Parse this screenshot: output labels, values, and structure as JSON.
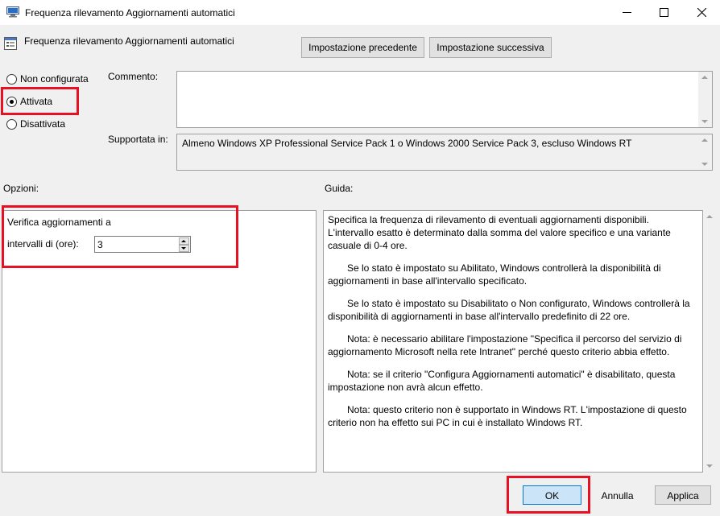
{
  "window": {
    "title": "Frequenza rilevamento Aggiornamenti automatici"
  },
  "header": {
    "policy_name": "Frequenza rilevamento Aggiornamenti automatici",
    "prev_label": "Impostazione precedente",
    "next_label": "Impostazione successiva"
  },
  "state": {
    "options": [
      {
        "label": "Non configurata",
        "selected": false
      },
      {
        "label": "Attivata",
        "selected": true
      },
      {
        "label": "Disattivata",
        "selected": false
      }
    ]
  },
  "comment": {
    "label": "Commento:",
    "value": ""
  },
  "supported": {
    "label": "Supportata in:",
    "value": "Almeno Windows XP Professional Service Pack 1 o Windows 2000 Service Pack 3, escluso Windows RT"
  },
  "options_panel": {
    "heading": "Opzioni:",
    "line1": "Verifica aggiornamenti a",
    "field_label": "intervalli di (ore):",
    "field_value": "3"
  },
  "help_panel": {
    "heading": "Guida:",
    "paragraphs": [
      "Specifica la frequenza di rilevamento di eventuali aggiornamenti disponibili. L'intervallo esatto è determinato dalla somma del valore specifico e una variante casuale di 0-4 ore.",
      "Se lo stato è impostato su Abilitato, Windows controllerà la disponibilità di aggiornamenti in base all'intervallo specificato.",
      "Se lo stato è impostato su Disabilitato o Non configurato, Windows controllerà la disponibilità di aggiornamenti in base all'intervallo predefinito di 22 ore.",
      "Nota: è necessario abilitare l'impostazione \"Specifica il percorso del servizio di aggiornamento Microsoft nella rete Intranet\" perché questo criterio abbia effetto.",
      "Nota: se il criterio \"Configura Aggiornamenti automatici\" è disabilitato, questa impostazione non avrà alcun effetto.",
      "Nota: questo criterio non è supportato in Windows RT. L'impostazione di questo criterio non ha effetto sui PC in cui è installato Windows RT."
    ]
  },
  "footer": {
    "ok_label": "OK",
    "cancel_label": "Annulla",
    "apply_label": "Applica"
  },
  "colors": {
    "highlight": "#e81123",
    "ok_border": "#0078d7",
    "ok_fill": "#cce4f7"
  }
}
